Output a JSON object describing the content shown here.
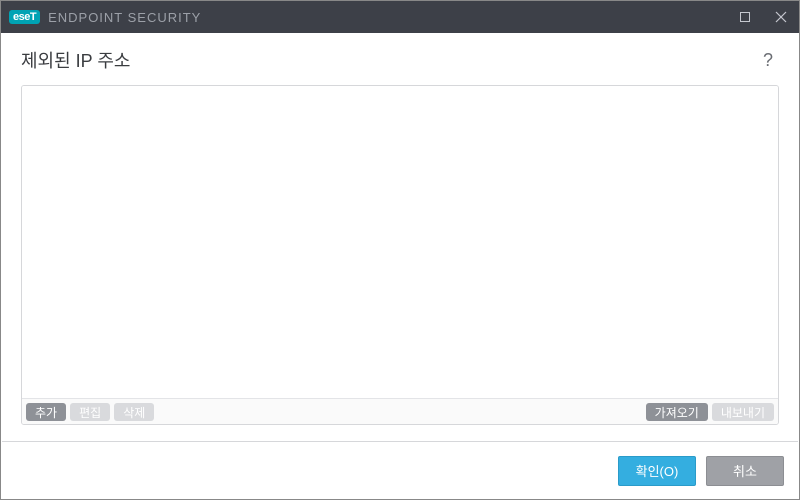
{
  "titlebar": {
    "logo_text": "eseT",
    "product_name": "ENDPOINT SECURITY"
  },
  "page": {
    "title": "제외된 IP 주소",
    "help_glyph": "?"
  },
  "list": {
    "items": []
  },
  "toolbar": {
    "add_label": "추가",
    "edit_label": "편집",
    "delete_label": "삭제",
    "import_label": "가져오기",
    "export_label": "내보내기"
  },
  "footer": {
    "ok_label": "확인(O)",
    "cancel_label": "취소"
  }
}
